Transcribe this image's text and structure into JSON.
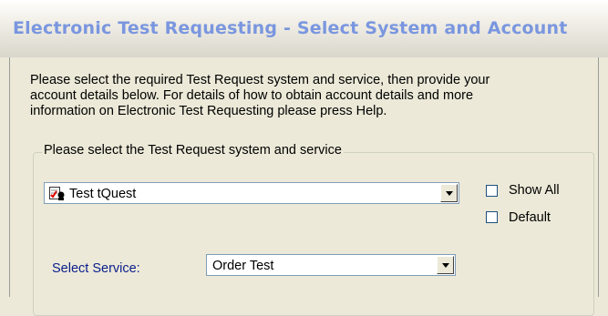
{
  "window": {
    "title": "Electronic Test Requesting - Select System and Account"
  },
  "description": {
    "lines": [
      "Please select the required Test Request system and service, then provide your",
      "account details below. For details of how to obtain account details and more",
      "information on Electronic Test Requesting please press Help."
    ]
  },
  "system_group": {
    "legend": "Please select the Test Request system and service",
    "system_select": {
      "value": "Test tQuest",
      "icon": "tquest-system-icon"
    },
    "show_all": {
      "label": "Show All",
      "checked": false
    },
    "default": {
      "label": "Default",
      "checked": false
    },
    "service": {
      "label": "Select Service:",
      "value": "Order Test"
    }
  },
  "colors": {
    "title_text": "#7a96df",
    "dialog_bg": "#ece9d8",
    "field_border": "#7f9db9",
    "service_label": "#0b1e8c"
  }
}
